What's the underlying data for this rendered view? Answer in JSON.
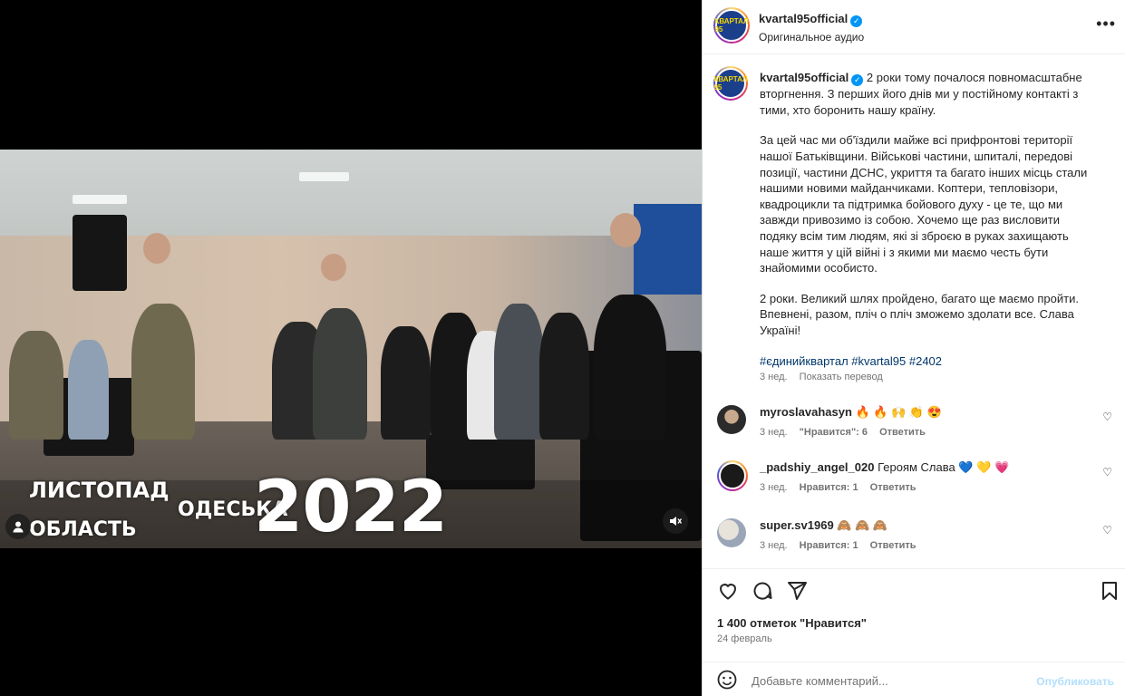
{
  "video": {
    "overlay_month": "ЛИСТОПАД",
    "overlay_region": "ОБЛАСТЬ",
    "overlay_city": "ОДЕСЬКА",
    "overlay_year": "2022",
    "user_tag_icon": "person-icon",
    "mute_icon": "speaker-muted-icon"
  },
  "header": {
    "username": "kvartal95official",
    "audio": "Оригинальное аудио",
    "more_icon": "more-horizontal-icon",
    "avatar_text": "КВАРТАЛ 95"
  },
  "caption": {
    "username": "kvartal95official",
    "p1": "2 роки тому почалося повномасштабне вторгнення. З перших його днів ми у постійному контакті з тими, хто боронить нашу країну.",
    "p2": "За цей час ми об'їздили майже всі прифронтові території нашої Батьківщини. Військові частини, шпиталі, передові позиції, частини ДСНС, укриття та багато інших місць стали нашими новими майданчиками. Коптери, тепловізори, квадроцикли та підтримка бойового духу - це те, що ми завжди привозимо із собою. Хочемо ще раз висловити подяку всім тим людям, які зі зброєю в руках захищають наше життя у цій війні і з якими ми маємо честь бути знайомими особисто.",
    "p3": "2 роки. Великий шлях пройдено, багато ще маємо пройти. Впевнені, разом, пліч о пліч зможемо здолати все. Слава Україні!",
    "tags": "#єдинийквартал #kvartal95 #2402",
    "time": "3 нед.",
    "translate": "Показать перевод"
  },
  "comments": [
    {
      "user": "myroslavahasyn",
      "text": "🔥 🔥 🙌 👏 😍",
      "time": "3 нед.",
      "likes": "\"Нравится\": 6",
      "reply": "Ответить"
    },
    {
      "user": "_padshiy_angel_020",
      "text": "Героям Слава 💙 💛 💗",
      "time": "3 нед.",
      "likes": "Нравится: 1",
      "reply": "Ответить"
    },
    {
      "user": "super.sv1969",
      "text": "🙈 🙈 🙈",
      "time": "3 нед.",
      "likes": "Нравится: 1",
      "reply": "Ответить"
    }
  ],
  "actions": {
    "like_icon": "heart-icon",
    "comment_icon": "comment-icon",
    "share_icon": "share-icon",
    "save_icon": "bookmark-icon"
  },
  "likes": "1 400 отметок \"Нравится\"",
  "date": "24 февраль",
  "add_comment": {
    "placeholder": "Добавьте комментарий...",
    "publish": "Опубликовать",
    "emoji_icon": "smiley-icon"
  }
}
